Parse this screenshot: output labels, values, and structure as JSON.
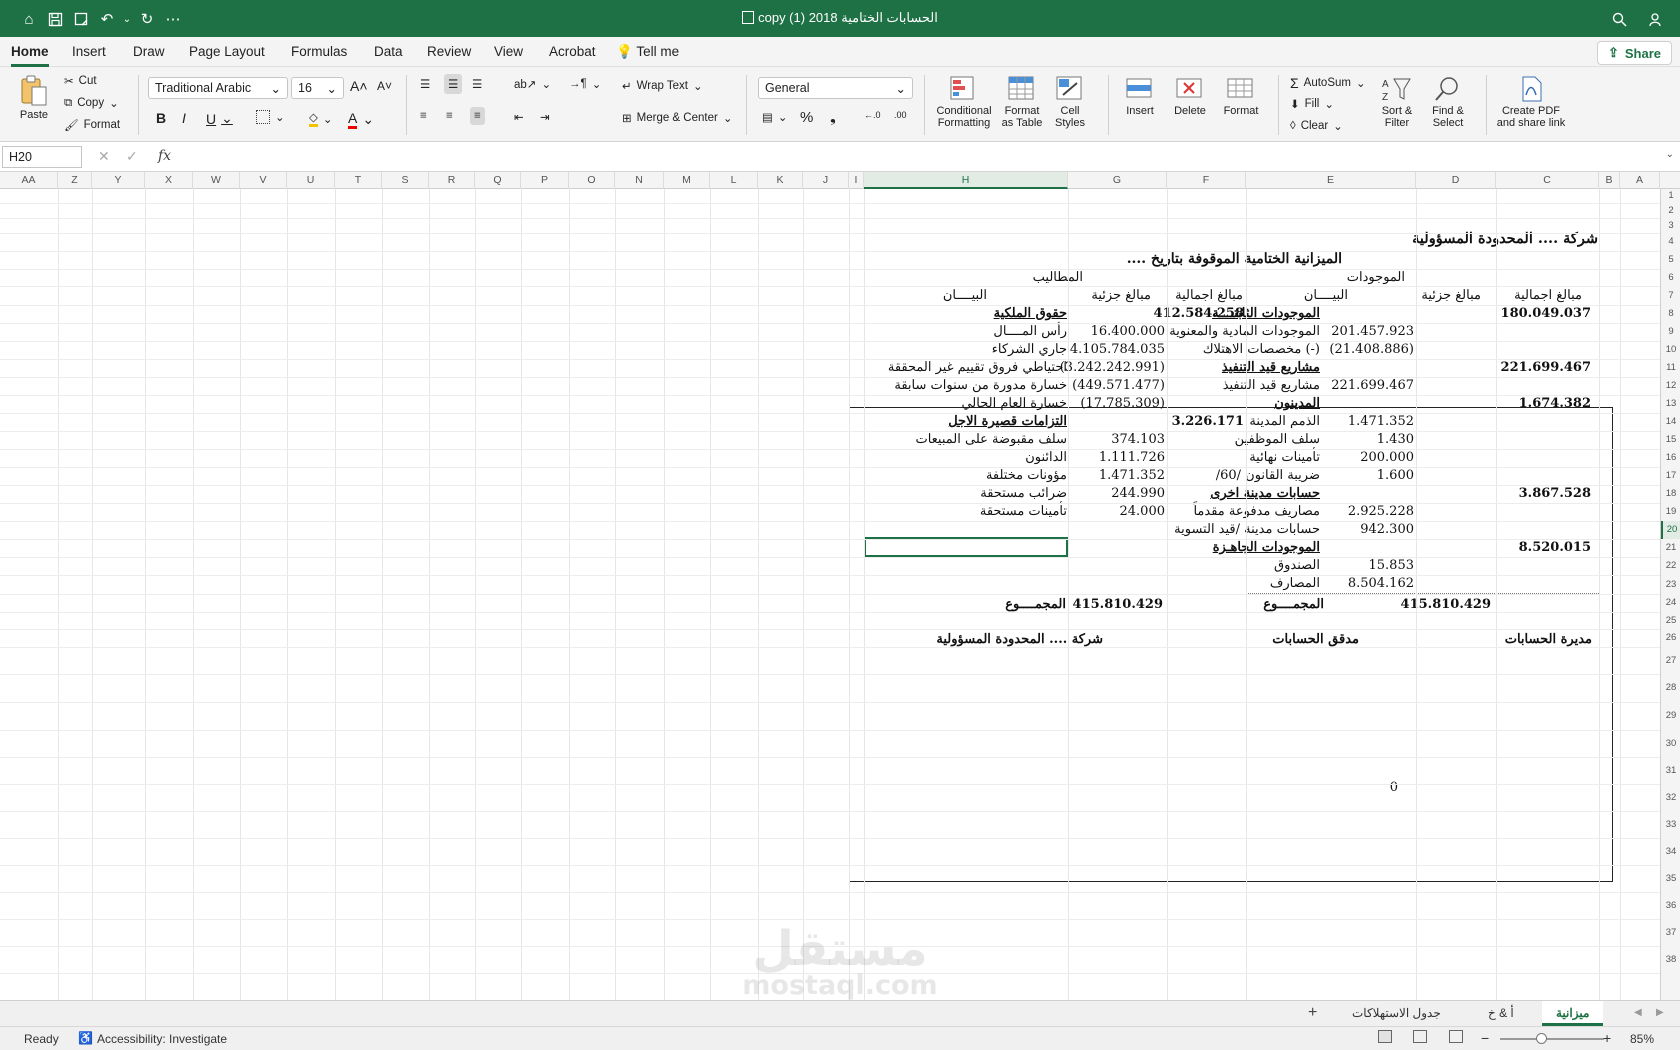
{
  "titlebar": {
    "title": "copy (1) الحسابات الختامية 2018",
    "quick_access": [
      "home-icon",
      "save-icon",
      "save-as-icon",
      "undo-icon",
      "redo-icon",
      "more-icon"
    ]
  },
  "menu": {
    "tabs": [
      "Home",
      "Insert",
      "Draw",
      "Page Layout",
      "Formulas",
      "Data",
      "Review",
      "View",
      "Acrobat"
    ],
    "tell_me": "Tell me",
    "share": "Share"
  },
  "ribbon": {
    "paste": "Paste",
    "cut": "Cut",
    "copy": "Copy",
    "format_painter": "Format",
    "font_name": "Traditional Arabic",
    "font_size": "16",
    "wrap_text": "Wrap Text",
    "merge_center": "Merge & Center",
    "number_format": "General",
    "conditional_formatting": [
      "Conditional",
      "Formatting"
    ],
    "format_as_table": [
      "Format",
      "as Table"
    ],
    "cell_styles": [
      "Cell",
      "Styles"
    ],
    "insert": "Insert",
    "delete": "Delete",
    "format": "Format",
    "autosum": "AutoSum",
    "fill": "Fill",
    "clear": "Clear",
    "sort_filter": [
      "Sort &",
      "Filter"
    ],
    "find_select": [
      "Find &",
      "Select"
    ],
    "create_pdf": [
      "Create PDF",
      "and share link"
    ]
  },
  "formula_bar": {
    "name_box": "H20",
    "fx": "fx",
    "content": ""
  },
  "columns": [
    "AA",
    "Z",
    "Y",
    "X",
    "W",
    "V",
    "U",
    "T",
    "S",
    "R",
    "Q",
    "P",
    "O",
    "N",
    "M",
    "L",
    "K",
    "J",
    "I",
    "H",
    "G",
    "F",
    "E",
    "D",
    "C",
    "B",
    "A"
  ],
  "rows": [
    "1",
    "2",
    "3",
    "4",
    "5",
    "6",
    "7",
    "8",
    "9",
    "10",
    "11",
    "12",
    "13",
    "14",
    "15",
    "16",
    "17",
    "18",
    "19",
    "20",
    "21",
    "22",
    "23",
    "24",
    "25",
    "26",
    "27",
    "28",
    "29",
    "30",
    "31",
    "32",
    "33",
    "34",
    "35",
    "36",
    "37",
    "38"
  ],
  "sheet": {
    "company": "شركة .... المحدودة المسؤولية",
    "report_title": "الميزانية الختامية الموقوفة بتاريخ ....",
    "assets_header": "الموجودات",
    "liabilities_header": "المطاليب",
    "col_total": "مبالغ اجمالية",
    "col_partial": "مبالغ جزئية",
    "col_desc": "البيــــان",
    "assets": [
      {
        "desc": "الموجودات الثابتــــة",
        "partial": "",
        "total": "180.049.037",
        "heading": true
      },
      {
        "desc": "الموجودات المادية والمعنوية",
        "partial": "201.457.923",
        "total": ""
      },
      {
        "desc": "(-) مخصصات الاهتلاك",
        "partial": "(21.408.886)",
        "total": ""
      },
      {
        "desc": "مشاريع قيد التنفيذ",
        "partial": "",
        "total": "221.699.467",
        "heading": true
      },
      {
        "desc": "مشاريع قيد التنفيذ",
        "partial": "221.699.467",
        "total": ""
      },
      {
        "desc": "المدينون",
        "partial": "",
        "total": "1.674.382",
        "heading": true
      },
      {
        "desc": "الذمم المدينة",
        "partial": "1.471.352",
        "total": ""
      },
      {
        "desc": "سلف الموظفين",
        "partial": "1.430",
        "total": ""
      },
      {
        "desc": "تأمينات نهائية",
        "partial": "200.000",
        "total": ""
      },
      {
        "desc": "ضريبة القانون /60/",
        "partial": "1.600",
        "total": ""
      },
      {
        "desc": "حسابات مدينة اخرى",
        "partial": "",
        "total": "3.867.528",
        "heading": true
      },
      {
        "desc": "مصاريف مدفوعة مقدماً",
        "partial": "2.925.228",
        "total": ""
      },
      {
        "desc": "حسابات مدينة /قيد التسوية",
        "partial": "942.300",
        "total": ""
      },
      {
        "desc": "الموجودات الجاهـزة",
        "partial": "",
        "total": "8.520.015",
        "heading": true
      },
      {
        "desc": "الصندوق",
        "partial": "15.853",
        "total": ""
      },
      {
        "desc": "المصارف",
        "partial": "8.504.162",
        "total": ""
      }
    ],
    "liabilities": [
      {
        "desc": "حقوق الملكية",
        "partial": "",
        "total": "412.584.258",
        "heading": true
      },
      {
        "desc": "رأس المــــال",
        "partial": "16.400.000",
        "total": ""
      },
      {
        "desc": "جاري الشركاء",
        "partial": "4.105.784.035",
        "total": ""
      },
      {
        "desc": "احتياطي فروق تقييم غير المحققة",
        "partial": "(3.242.242.991)",
        "total": ""
      },
      {
        "desc": "خسارة مدورة من سنوات سابقة",
        "partial": "(449.571.477)",
        "total": ""
      },
      {
        "desc": "خسارة العام الحالي",
        "partial": "(17.785.309)",
        "total": ""
      },
      {
        "desc": "التزامات قصيرة الاجل",
        "partial": "",
        "total": "3.226.171",
        "heading": true
      },
      {
        "desc": "سلف مقبوضة على المبيعات",
        "partial": "374.103",
        "total": ""
      },
      {
        "desc": "الدائنون",
        "partial": "1.111.726",
        "total": ""
      },
      {
        "desc": "مؤونات مختلفة",
        "partial": "1.471.352",
        "total": ""
      },
      {
        "desc": "ضرائب مستحقة",
        "partial": "244.990",
        "total": ""
      },
      {
        "desc": "تأمينات مستحقة",
        "partial": "24.000",
        "total": ""
      }
    ],
    "total_label": "المجمــــوع",
    "assets_total": "415.810.429",
    "liabilities_total": "415.810.429",
    "sign_1": "مديرة الحسابات",
    "sign_2": "مدقق الحسابات",
    "sign_3": "شركة .... المحدودة المسؤولية",
    "stray_zero": "0"
  },
  "sheet_tabs": [
    "ميزانية",
    "أ & خ",
    "جدول الاستهلاكات"
  ],
  "status": {
    "ready": "Ready",
    "accessibility": "Accessibility: Investigate",
    "zoom": "85%"
  },
  "watermark": {
    "arabic": "مستقل",
    "latin": "mostaql.com"
  },
  "colors": {
    "accent": "#1e7145",
    "ribbon_bg": "#f4f4f4"
  }
}
